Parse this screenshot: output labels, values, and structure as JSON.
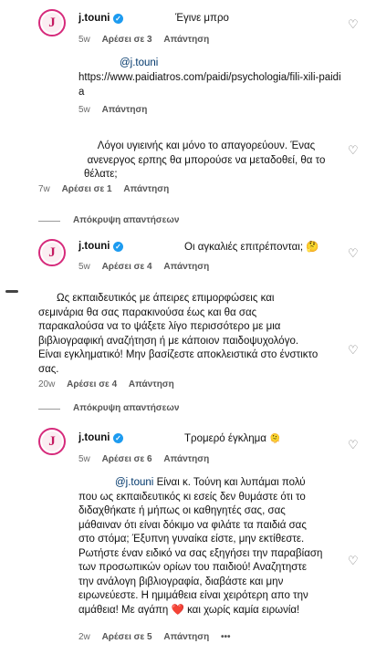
{
  "comments": [
    {
      "username": "j.touni",
      "avatar_letter": "J",
      "text": "Έγινε μπρο",
      "time": "5w",
      "likes_label": "Αρέσει σε 3",
      "reply_label": "Απάντηση"
    },
    {
      "mention": "@j.touni",
      "link": "https://www.paidiatros.com/paidi/psychologia/fili-xili-paidia",
      "time": "5w",
      "reply_label": "Απάντηση"
    },
    {
      "lines": [
        "Λόγοι υγιεινής και μόνο το απαγορεύουν. Ένας",
        "ανενεργος ερπης θα μπορούσε να μεταδοθεί, θα το",
        "θέλατε;"
      ],
      "time": "7w",
      "likes_label": "Αρέσει σε 1",
      "reply_label": "Απάντηση"
    },
    {
      "username": "j.touni",
      "avatar_letter": "J",
      "text": "Οι αγκαλιές επιτρέπονται;",
      "emoji": "🤔",
      "time": "5w",
      "likes_label": "Αρέσει σε 4",
      "reply_label": "Απάντηση"
    },
    {
      "lines": [
        "Ως εκπαιδευτικός με άπειρες επιμορφώσεις και",
        "σεμινάρια θα σας παρακινούσα έως και θα σας",
        "παρακαλούσα να το ψάξετε λίγο περισσότερο με μια",
        "βιβλιογραφική αναζήτηση ή με κάποιον παιδοψυχολόγο.",
        "Είναι εγκληματικό! Μην βασίζεστε αποκλειστικά στο ένστικτο",
        "σας."
      ],
      "time": "20w",
      "likes_label": "Αρέσει σε 4",
      "reply_label": "Απάντηση"
    },
    {
      "username": "j.touni",
      "avatar_letter": "J",
      "text": "Τρομερό έγκλημα",
      "emoji": "🫠",
      "time": "5w",
      "likes_label": "Αρέσει σε 6",
      "reply_label": "Απάντηση"
    },
    {
      "mention": "@j.touni",
      "lines": [
        "Είναι κ. Τούνη και λυπάμαι πολύ",
        "που ως εκπαιδευτικός κι εσείς δεν θυμάστε ότι το",
        "διδαχθήκατε ή μήπως οι καθηγητές σας, σας",
        "μάθαιναν ότι είναι δόκιμο να φιλάτε τα παιδιά σας",
        "στο στόμα; Έξυπνη γυναίκα είστε, μην εκτίθεστε.",
        "Ρωτήστε έναν ειδικό να σας εξηγήσει την παραβίαση",
        "των προσωπικών ορίων του παιδιού! Αναζητηστε",
        "την ανάλογη βιβλιογραφία, διαβάστε και μην",
        "ειρωνεύεστε. Η ημιμάθεια είναι χειρότερη απο την",
        "αμάθεια! Με αγάπη",
        "και χωρίς καμία ειρωνία!"
      ],
      "heart_emoji": "❤️",
      "time": "2w",
      "likes_label": "Αρέσει σε 5",
      "reply_label": "Απάντηση",
      "more": "•••"
    }
  ],
  "hide_replies_label": "Απόκρυψη απαντήσεων",
  "icons": {
    "like": "heart-outline-icon",
    "verified": "verified-badge-icon"
  },
  "colors": {
    "avatar_ring": "#d62a7b",
    "verified": "#1d9bf0",
    "heart_emoji": "#e0245e"
  }
}
